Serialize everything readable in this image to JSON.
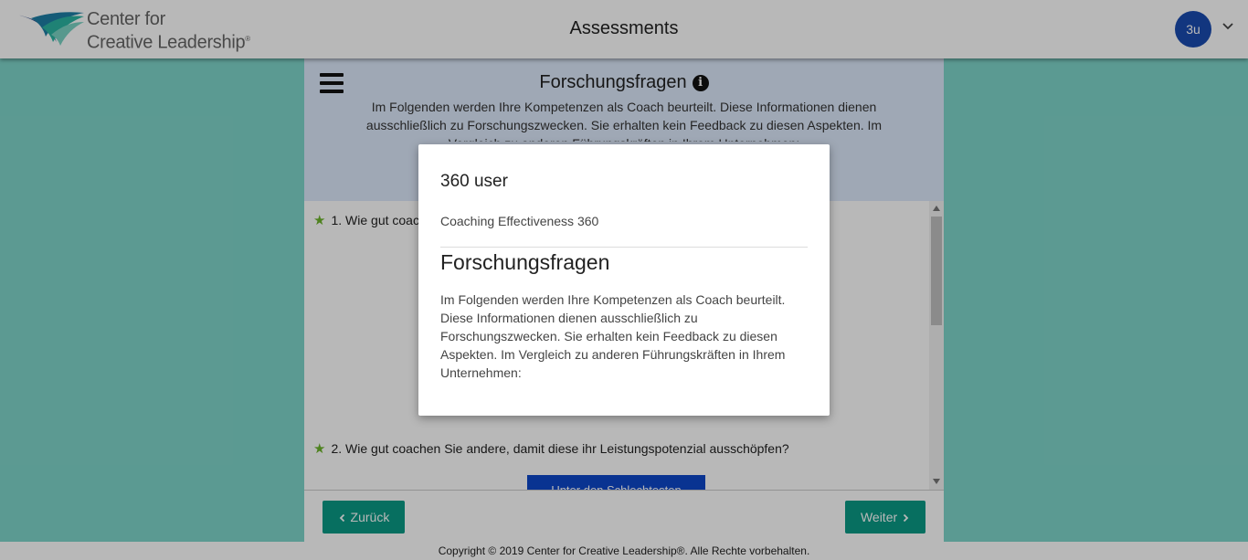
{
  "header": {
    "logo_line1": "Center for",
    "logo_line2": "Creative Leadership",
    "logo_mark": "®",
    "title": "Assessments",
    "avatar_initials": "3u",
    "avatar_color": "#1a4bb0",
    "menu_icon": "chevron-down-icon"
  },
  "panel": {
    "title": "Forschungsfragen",
    "info_icon": "i",
    "description": "Im Folgenden werden Ihre Kompetenzen als Coach beurteilt. Diese Informationen dienen ausschließlich zu Forschungszwecken. Sie erhalten kein Feedback zu diesen Aspekten. Im Vergleich zu anderen Führungskräften in Ihrem Unternehmen:",
    "questions": [
      {
        "number": "1.",
        "text": "Wie gut coachen Sie andere, damit diese ihr Leistungspotenzial ausschöpfen?"
      },
      {
        "number": "2.",
        "text": "Wie gut coachen Sie andere, damit diese ihr Leistungspotenzial ausschöpfen?"
      }
    ],
    "answer_button_label": "Unter den Schlechtesten",
    "star_color": "#6cb42c"
  },
  "nav": {
    "back_label": "Zurück",
    "next_label": "Weiter",
    "button_color": "#0a9a86"
  },
  "footer": {
    "copyright": "Copyright © 2019 Center for Creative Leadership®. Alle Rechte vorbehalten."
  },
  "modal": {
    "user": "360 user",
    "assessment": "Coaching Effectiveness 360",
    "heading": "Forschungsfragen",
    "body": "Im Folgenden werden Ihre Kompetenzen als Coach beurteilt. Diese Informationen dienen ausschließlich zu Forschungszwecken. Sie erhalten kein Feedback zu diesen Aspekten. Im Vergleich zu anderen Führungskräften in Ihrem Unternehmen:"
  },
  "colors": {
    "page_background": "#7fd6cb",
    "panel_header_background": "#dde9fb"
  }
}
